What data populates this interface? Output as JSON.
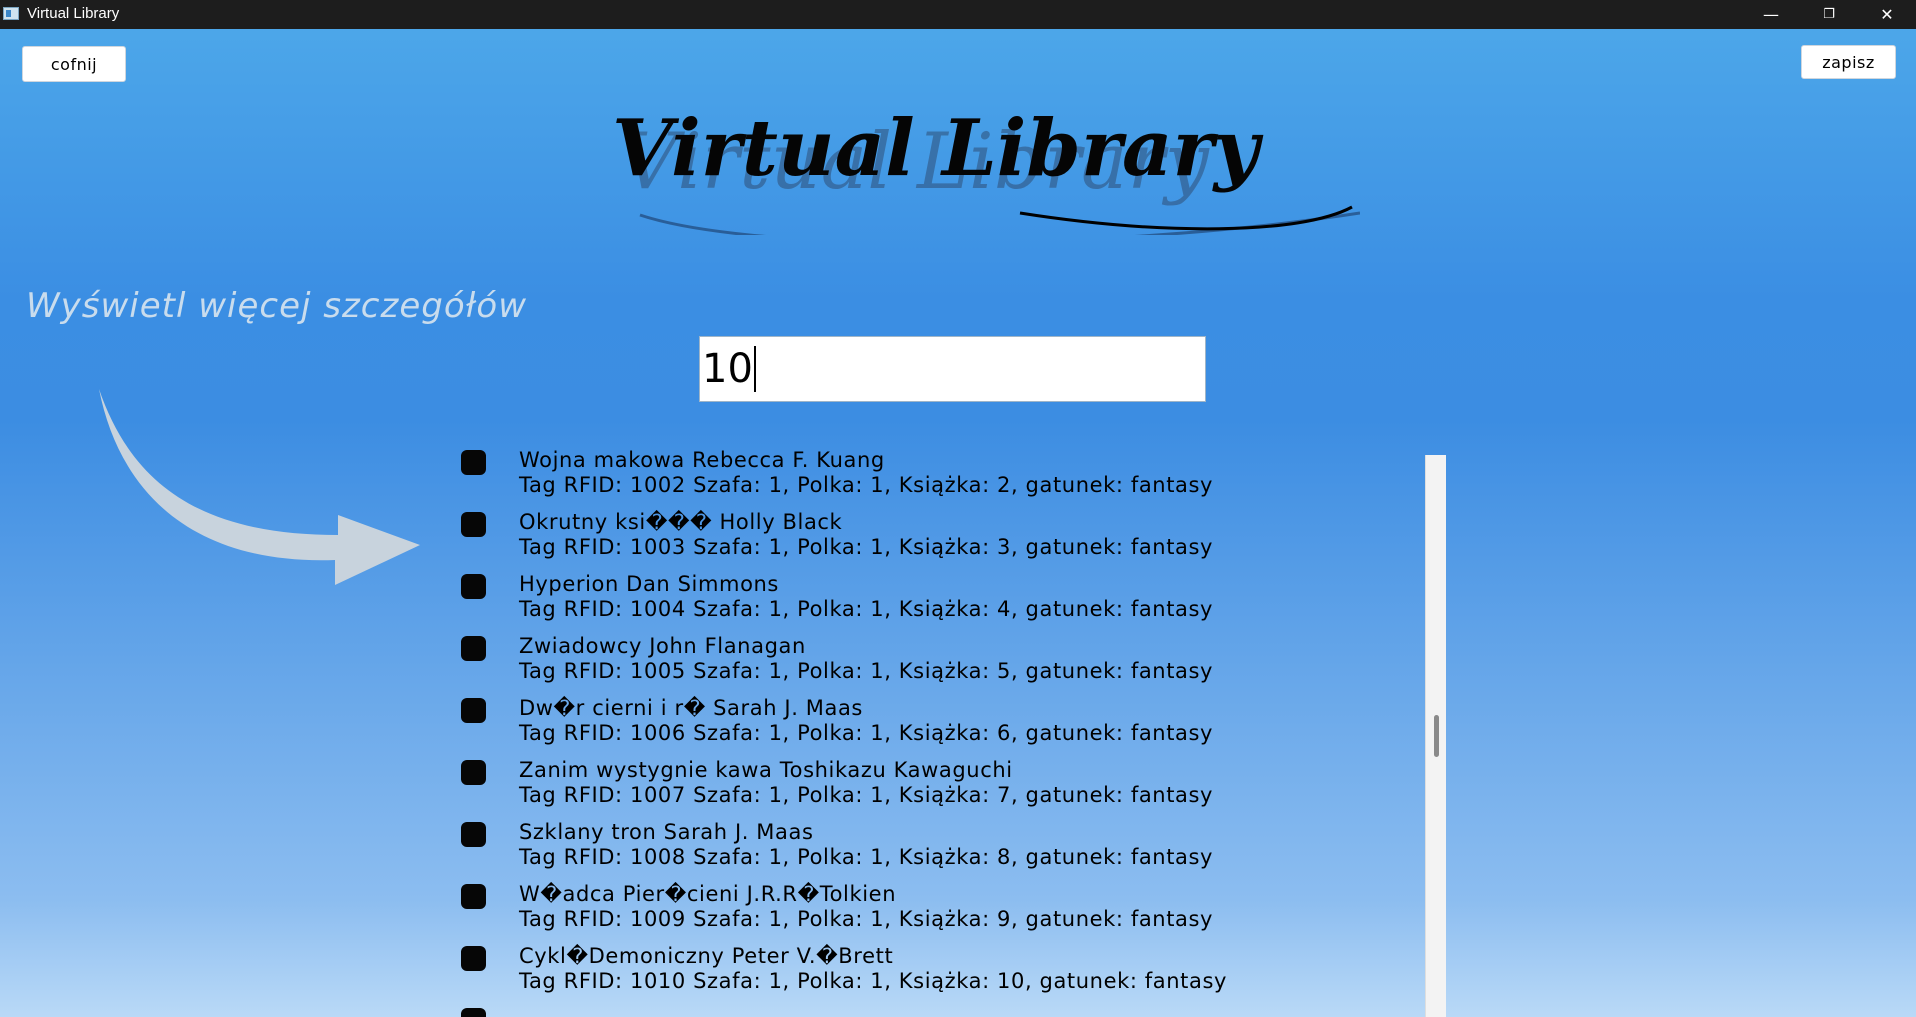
{
  "window": {
    "title": "Virtual Library",
    "controls": {
      "minimize": "—",
      "restore": "❐",
      "close": "✕"
    }
  },
  "toolbar": {
    "back_label": "cofnij",
    "save_label": "zapisz"
  },
  "header": {
    "logo_text": "Virtual Library"
  },
  "hint": {
    "text": "Wyświetl więcej szczegółów"
  },
  "search": {
    "value": "10"
  },
  "books": [
    {
      "title": "Wojna makowa Rebecca F. Kuang",
      "detail": "Tag RFID: 1002 Szafa: 1, Polka: 1, Książka: 2, gatunek: fantasy"
    },
    {
      "title": "Okrutny ksi��� Holly Black",
      "detail": "Tag RFID: 1003 Szafa: 1, Polka: 1, Książka: 3, gatunek: fantasy"
    },
    {
      "title": "Hyperion Dan Simmons",
      "detail": "Tag RFID: 1004 Szafa: 1, Polka: 1, Książka: 4, gatunek: fantasy"
    },
    {
      "title": "Zwiadowcy John Flanagan",
      "detail": "Tag RFID: 1005 Szafa: 1, Polka: 1, Książka: 5, gatunek: fantasy"
    },
    {
      "title": "Dw�r cierni i r� Sarah J. Maas",
      "detail": "Tag RFID: 1006 Szafa: 1, Polka: 1, Książka: 6, gatunek: fantasy"
    },
    {
      "title": "Zanim wystygnie kawa Toshikazu Kawaguchi",
      "detail": "Tag RFID: 1007 Szafa: 1, Polka: 1, Książka: 7, gatunek: fantasy"
    },
    {
      "title": "Szklany tron Sarah J. Maas",
      "detail": "Tag RFID: 1008 Szafa: 1, Polka: 1, Książka: 8, gatunek: fantasy"
    },
    {
      "title": "W�adca Pier�cieni J.R.R�Tolkien",
      "detail": "Tag RFID: 1009 Szafa: 1, Polka: 1, Książka: 9, gatunek: fantasy"
    },
    {
      "title": "Cykl�Demoniczny Peter V.�Brett",
      "detail": "Tag RFID: 1010 Szafa: 1, Polka: 1, Książka: 10, gatunek: fantasy"
    }
  ]
}
